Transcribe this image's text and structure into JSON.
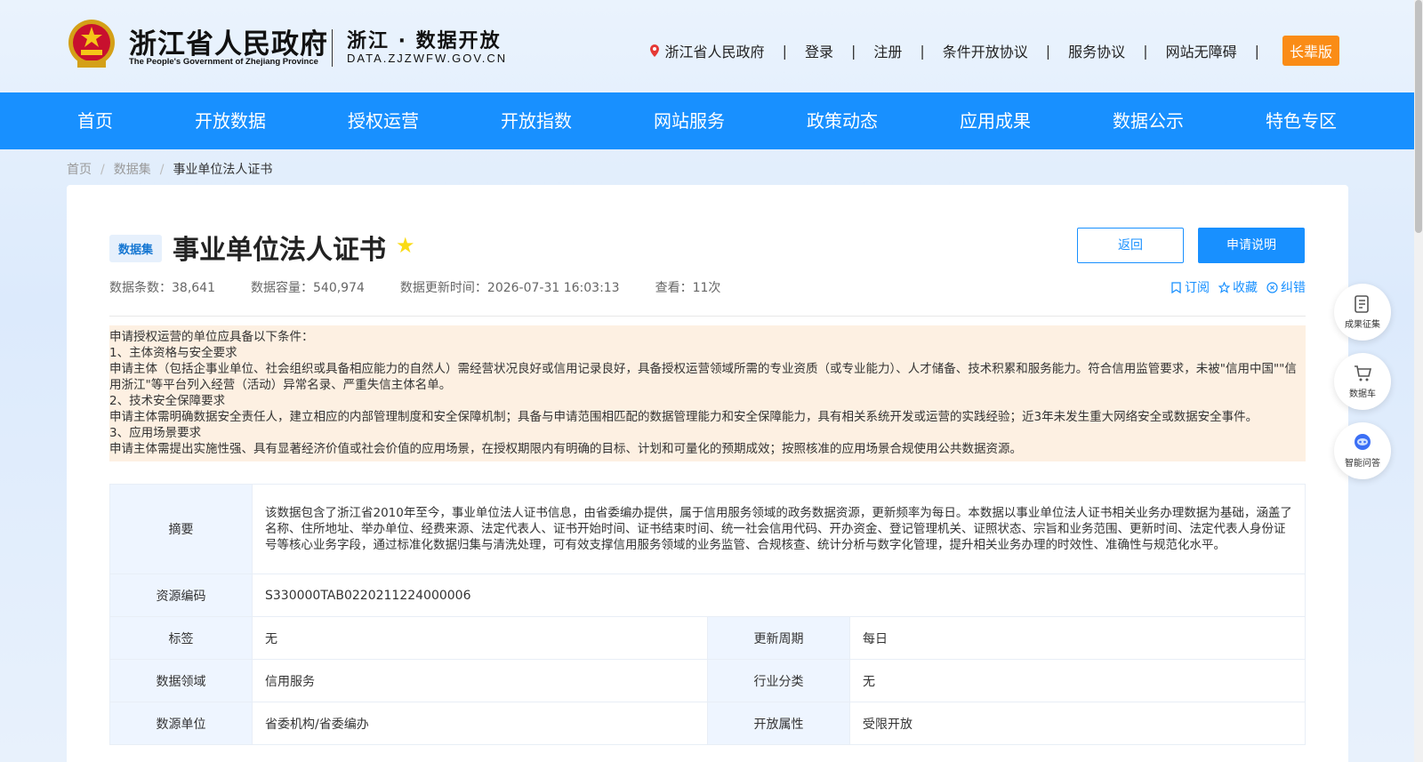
{
  "header": {
    "gov_title": "浙江省人民政府",
    "gov_sub": "The People's Government of Zhejiang Province",
    "portal_title": "浙江 · 数据开放",
    "portal_url": "DATA.ZJZWFW.GOV.CN",
    "links": [
      "浙江省人民政府",
      "登录",
      "注册",
      "条件开放协议",
      "服务协议",
      "网站无障碍"
    ],
    "elder_label": "长辈版"
  },
  "nav": {
    "items": [
      "首页",
      "开放数据",
      "授权运营",
      "开放指数",
      "网站服务",
      "政策动态",
      "应用成果",
      "数据公示",
      "特色专区"
    ]
  },
  "breadcrumb": {
    "home": "首页",
    "level1": "数据集",
    "current": "事业单位法人证书"
  },
  "dataset": {
    "badge": "数据集",
    "title": "事业单位法人证书",
    "back_label": "返回",
    "apply_label": "申请说明",
    "meta": {
      "records": "数据条数：38,641",
      "capacity": "数据容量：540,974",
      "updated": "数据更新时间：2026-07-31 16:03:13",
      "views": "查看：11次"
    },
    "actions": {
      "subscribe": "订阅",
      "favorite": "收藏",
      "correct": "纠错"
    }
  },
  "notice": {
    "lines": [
      "申请授权运营的单位应具备以下条件：",
      "1、主体资格与安全要求",
      "申请主体（包括企事业单位、社会组织或具备相应能力的自然人）需经营状况良好或信用记录良好，具备授权运营领域所需的专业资质（或专业能力）、人才储备、技术积累和服务能力。符合信用监管要求，未被\"信用中国\"\"信用浙江\"等平台列入经营（活动）异常名录、严重失信主体名单。",
      "2、技术安全保障要求",
      "申请主体需明确数据安全责任人，建立相应的内部管理制度和安全保障机制；具备与申请范围相匹配的数据管理能力和安全保障能力，具有相关系统开发或运营的实践经验；近3年未发生重大网络安全或数据安全事件。",
      "3、应用场景要求",
      "申请主体需提出实施性强、具有显著经济价值或社会价值的应用场景，在授权期限内有明确的目标、计划和可量化的预期成效；按照核准的应用场景合规使用公共数据资源。"
    ]
  },
  "info": {
    "summary_label": "摘要",
    "summary": "该数据包含了浙江省2010年至今，事业单位法人证书信息，由省委编办提供，属于信用服务领域的政务数据资源，更新频率为每日。本数据以事业单位法人证书相关业务办理数据为基础，涵盖了名称、住所地址、举办单位、经费来源、法定代表人、证书开始时间、证书结束时间、统一社会信用代码、开办资金、登记管理机关、证照状态、宗旨和业务范围、更新时间、法定代表人身份证号等核心业务字段，通过标准化数据归集与清洗处理，可有效支撑信用服务领域的业务监管、合规核查、统计分析与数字化管理，提升相关业务办理的时效性、准确性与规范化水平。",
    "code_label": "资源编码",
    "code": "S330000TAB0220211224000006",
    "rows": [
      {
        "l1": "标签",
        "v1": "无",
        "l2": "更新周期",
        "v2": "每日"
      },
      {
        "l1": "数据领域",
        "v1": "信用服务",
        "l2": "行业分类",
        "v2": "无"
      },
      {
        "l1": "数源单位",
        "v1": "省委机构/省委编办",
        "l2": "开放属性",
        "v2": "受限开放"
      }
    ]
  },
  "floating": {
    "results": "成果征集",
    "cart": "数据车",
    "ai": "智能问答"
  }
}
